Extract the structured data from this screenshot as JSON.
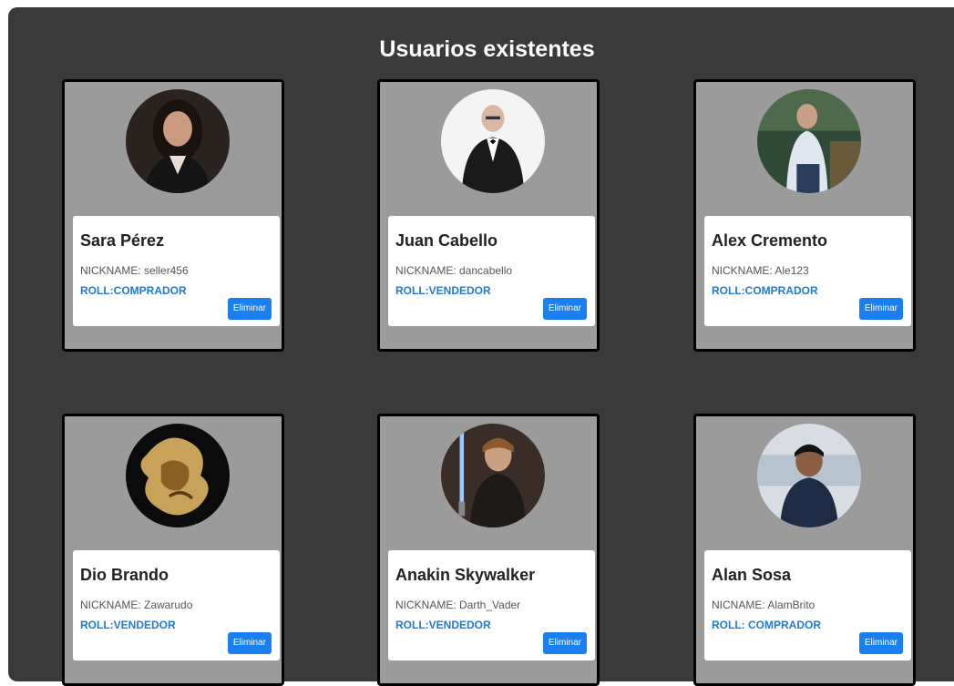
{
  "page": {
    "title": "Usuarios existentes"
  },
  "users": [
    {
      "name": "Sara Pérez",
      "nickname": "NICKNAME: seller456",
      "roll": "ROLL:COMPRADOR",
      "button_label": "Eliminar",
      "avatar_icon": "woman-with-long-hair-photo"
    },
    {
      "name": "Juan Cabello",
      "nickname": "NICKNAME: dancabello",
      "roll": "ROLL:VENDEDOR",
      "button_label": "Eliminar",
      "avatar_icon": "bald-man-in-suit-photo"
    },
    {
      "name": "Alex Cremento",
      "nickname": "NICKNAME: Ale123",
      "roll": "ROLL:COMPRADOR",
      "button_label": "Eliminar",
      "avatar_icon": "man-outdoors-photo"
    },
    {
      "name": "Dio Brando",
      "nickname": "NICKNAME: Zawarudo",
      "roll": "ROLL:VENDEDOR",
      "button_label": "Eliminar",
      "avatar_icon": "anime-character-artwork"
    },
    {
      "name": "Anakin Skywalker",
      "nickname": "NICKNAME: Darth_Vader",
      "roll": "ROLL:VENDEDOR",
      "button_label": "Eliminar",
      "avatar_icon": "man-with-lightsaber-photo"
    },
    {
      "name": "Alan Sosa",
      "nickname": "NICNAME: AlamBrito",
      "roll": "ROLL: COMPRADOR",
      "button_label": "Eliminar",
      "avatar_icon": "young-man-photo"
    }
  ],
  "colors": {
    "panel": "#3a3a3a",
    "card": "#9b9b9b",
    "roll_text": "#1f7ad4",
    "button": "#1a7ff0"
  }
}
